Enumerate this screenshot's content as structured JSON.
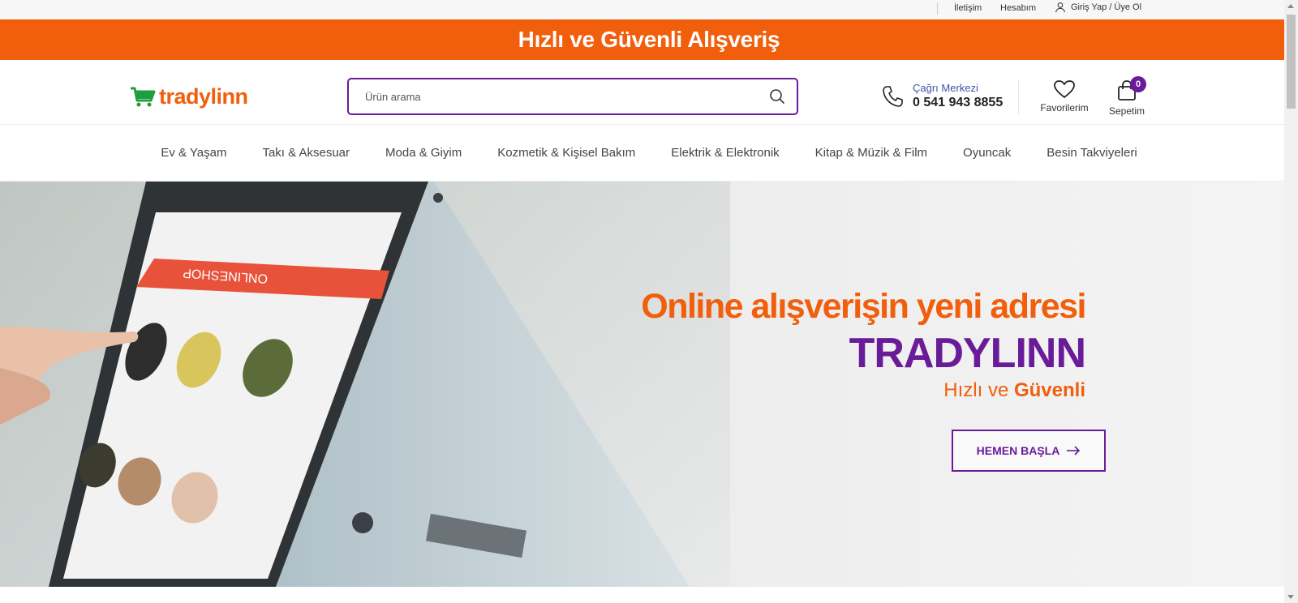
{
  "topbar": {
    "contact": "İletişim",
    "account": "Hesabım",
    "login": "Giriş Yap / Üye Ol"
  },
  "banner": {
    "text": "Hızlı ve Güvenli Alışveriş"
  },
  "header": {
    "logo_text": "tradylinn",
    "search_placeholder": "Ürün arama",
    "call_center_label": "Çağrı Merkezi",
    "call_center_number": "0 541 943 8855",
    "favorites_label": "Favorilerim",
    "basket_label": "Sepetim",
    "basket_count": "0"
  },
  "nav": {
    "items": [
      "Ev & Yaşam",
      "Takı & Aksesuar",
      "Moda & Giyim",
      "Kozmetik & Kişisel Bakım",
      "Elektrik & Elektronik",
      "Kitap & Müzik & Film",
      "Oyuncak",
      "Besin Takviyeleri"
    ]
  },
  "hero": {
    "headline": "Online alışverişin yeni adresi",
    "brand": "TRADYLINN",
    "tagline_prefix": "Hızlı ve ",
    "tagline_bold": "Güvenli",
    "cta_label": "HEMEN BAŞLA",
    "screen_text": "ONLINESHOP"
  },
  "colors": {
    "brand_orange": "#f15e0c",
    "brand_purple": "#6a1b9a",
    "phone_blue": "#3b56a6"
  }
}
